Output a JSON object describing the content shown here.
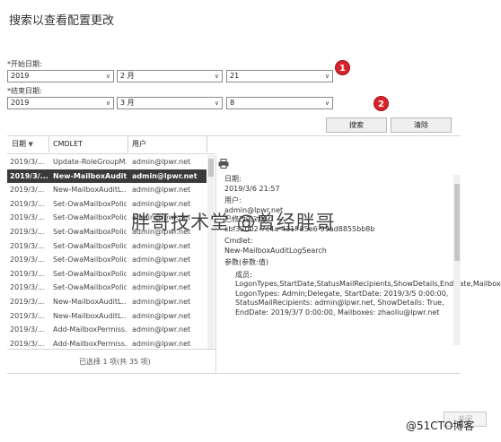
{
  "title": "搜索以查看配置更改",
  "start_date": {
    "label": "*开始日期:",
    "year": "2019",
    "month": "2 月",
    "day": "21"
  },
  "end_date": {
    "label": "*结束日期:",
    "year": "2019",
    "month": "3 月",
    "day": "8"
  },
  "markers": [
    "1",
    "2"
  ],
  "buttons": {
    "search": "搜索",
    "clear": "清除",
    "close": "关闭"
  },
  "table": {
    "headers": [
      "日期",
      "CMDLET",
      "用户"
    ],
    "rows": [
      {
        "date": "2019/3/...",
        "cmdlet": "Update-RoleGroupM...",
        "user": "admin@lpwr.net",
        "selected": false
      },
      {
        "date": "2019/3/...",
        "cmdlet": "New-MailboxAuditL...",
        "user": "admin@lpwr.net",
        "selected": true
      },
      {
        "date": "2019/3/...",
        "cmdlet": "New-MailboxAuditL...",
        "user": "admin@lpwr.net",
        "selected": false
      },
      {
        "date": "2019/3/...",
        "cmdlet": "Set-OwaMailboxPolicy",
        "user": "admin@lpwr.net",
        "selected": false
      },
      {
        "date": "2019/3/...",
        "cmdlet": "Set-OwaMailboxPolicy",
        "user": "admin@lpwr.net",
        "selected": false
      },
      {
        "date": "2019/3/...",
        "cmdlet": "Set-OwaMailboxPolicy",
        "user": "admin@lpwr.net",
        "selected": false
      },
      {
        "date": "2019/3/...",
        "cmdlet": "Set-OwaMailboxPolicy",
        "user": "admin@lpwr.net",
        "selected": false
      },
      {
        "date": "2019/3/...",
        "cmdlet": "Set-OwaMailboxPolicy",
        "user": "admin@lpwr.net",
        "selected": false
      },
      {
        "date": "2019/3/...",
        "cmdlet": "Set-OwaMailboxPolicy",
        "user": "admin@lpwr.net",
        "selected": false
      },
      {
        "date": "2019/3/...",
        "cmdlet": "Set-OwaMailboxPolicy",
        "user": "admin@lpwr.net",
        "selected": false
      },
      {
        "date": "2019/3/...",
        "cmdlet": "New-MailboxAuditL...",
        "user": "admin@lpwr.net",
        "selected": false
      },
      {
        "date": "2019/3/...",
        "cmdlet": "New-MailboxAuditL...",
        "user": "admin@lpwr.net",
        "selected": false
      },
      {
        "date": "2019/3/...",
        "cmdlet": "Add-MailboxPermiss...",
        "user": "admin@lpwr.net",
        "selected": false
      },
      {
        "date": "2019/3/...",
        "cmdlet": "Add-MailboxPermiss...",
        "user": "admin@lpwr.net",
        "selected": false
      }
    ]
  },
  "detail": {
    "date_label": "日期:",
    "date_value": "2019/3/6 21:57",
    "user_label": "用户:",
    "user_value": "admin@lpwr.net",
    "object_label": "已修改的对象:",
    "object_value": "cbf32002-7c4a-431f-85e6-99ad8855bb8b",
    "cmdlet_label": "Cmdlet:",
    "cmdlet_value": "New-MailboxAuditLogSearch",
    "params_label": "参数(参数:值)",
    "params": [
      "成员: LogonTypes,StartDate,StatusMailRecipients,ShowDetails,EndDate,Mailboxes",
      "LogonTypes: Admin;Delegate, StartDate: 2019/3/5 0:00:00, StatusMailRecipients: admin@lpwr.net, ShowDetails: True, EndDate: 2019/3/7 0:00:00, Mailboxes: zhaoliu@lpwr.net"
    ]
  },
  "selection_count": "已选择 1 项(共 35 项)",
  "watermark": "胖哥技术堂 @曾经胖哥",
  "site_logo": "@51CTO博客"
}
